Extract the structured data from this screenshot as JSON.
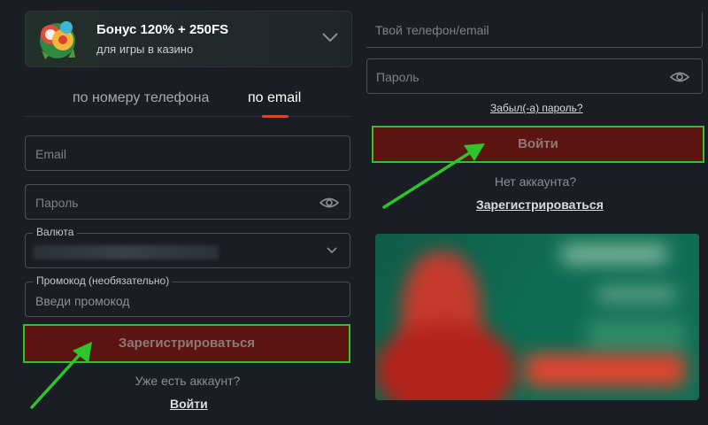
{
  "left": {
    "bonus": {
      "title": "Бонус 120% + 250FS",
      "subtitle": "для игры в казино"
    },
    "tabs": [
      {
        "label": "по номеру телефона",
        "active": false
      },
      {
        "label": "по email",
        "active": true
      }
    ],
    "email_field": {
      "placeholder": "Email"
    },
    "password_field": {
      "placeholder": "Пароль"
    },
    "currency_field": {
      "legend": "Валюта",
      "value": ""
    },
    "promo_field": {
      "legend": "Промокод (необязательно)",
      "placeholder": "Введи промокод"
    },
    "register_button": "Зарегистрироваться",
    "have_account_text": "Уже есть аккаунт?",
    "login_link": "Войти"
  },
  "right": {
    "phone_email_field": {
      "placeholder": "Твой телефон/email"
    },
    "password_field": {
      "placeholder": "Пароль"
    },
    "forgot_link": "Забыл(-а) пароль?",
    "login_button": "Войти",
    "no_account_text": "Нет аккаунта?",
    "register_link": "Зарегистрироваться"
  },
  "colors": {
    "accent_underline": "#e0452b",
    "cta_fill": "#5b1410",
    "highlight_green": "#2fc42a"
  },
  "icons": [
    "gift-icon",
    "chevron-down-icon",
    "eye-icon",
    "green-arrow-icon"
  ]
}
